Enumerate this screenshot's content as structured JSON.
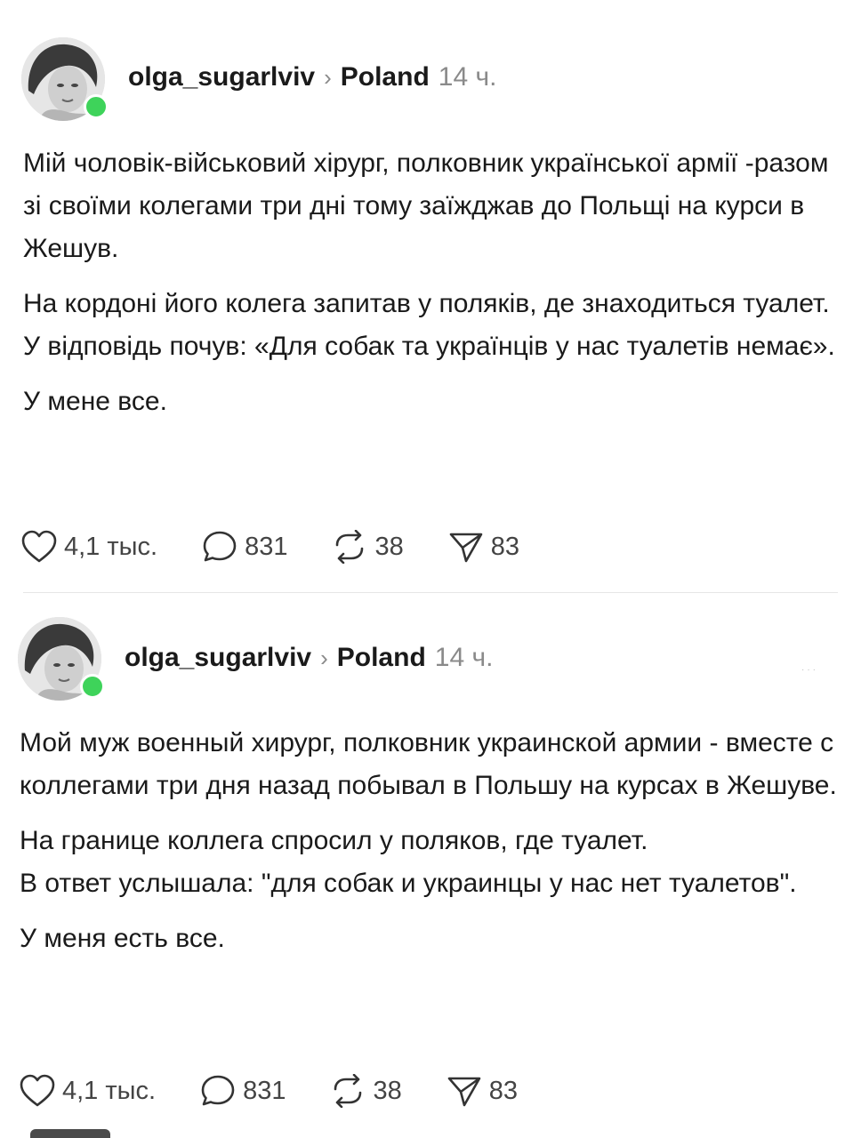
{
  "posts": [
    {
      "username": "olga_sugarlviv",
      "separator": "›",
      "location": "Poland",
      "time": "14 ч.",
      "paragraphs": [
        "Мій чоловік-військовий хірург, полковник української армії -разом зі своїми колегами три дні тому заїжджав до Польщі на курси в Жешув.",
        "На кордоні його колега запитав у поляків, де знаходиться туалет.",
        "У відповідь почув: «Для собак та українців у нас туалетів немає».",
        "У мене все."
      ],
      "likes": "4,1 тыс.",
      "comments": "831",
      "reposts": "38",
      "shares": "83"
    },
    {
      "username": "olga_sugarlviv",
      "separator": "›",
      "location": "Poland",
      "time": "14 ч.",
      "paragraphs": [
        "Мой муж военный хирург, полковник украинской армии - вместе с коллегами три дня назад побывал в Польшу на курсах в Жешуве.",
        "На границе коллега спросил у поляков, где туалет.",
        "В ответ услышала: \"для собак и украинцы у нас нет туалетов\".",
        "У меня есть все."
      ],
      "likes": "4,1 тыс.",
      "comments": "831",
      "reposts": "38",
      "shares": "83"
    }
  ],
  "icons": {
    "like": "heart-icon",
    "comment": "comment-bubble-icon",
    "repost": "repost-icon",
    "share": "send-icon"
  },
  "colors": {
    "online": "#3ed35a",
    "muted": "#8a8a8a",
    "text": "#1a1a1a"
  }
}
